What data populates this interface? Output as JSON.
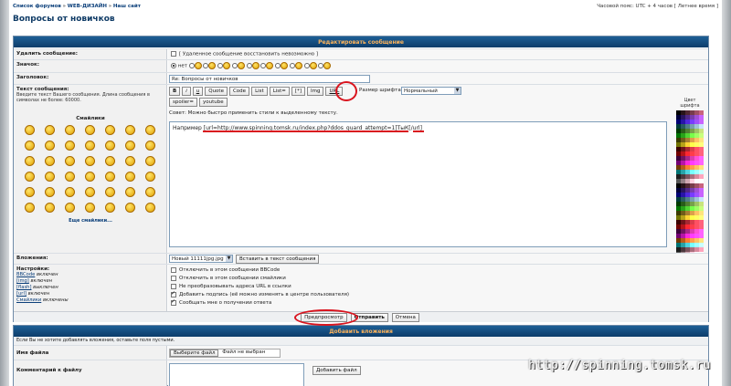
{
  "breadcrumbs": [
    "Список форумов",
    "WEB-ДИЗАЙН",
    "Наш сайт"
  ],
  "breadcrumb_sep": "»",
  "timezone": "Часовой пояс: UTC + 4 часов [ Летнее время ]",
  "page_title": "Вопросы от новичков",
  "edit_section_title": "Редактировать сообщение",
  "delete": {
    "label": "Удалить сообщение:",
    "text": "[ Удаленное сообщение восстановить невозможно ]"
  },
  "icon": {
    "label": "Значок:",
    "none_label": "нет"
  },
  "subject": {
    "label": "Заголовок:",
    "value": "Re: Вопросы от новичков"
  },
  "message": {
    "label": "Текст сообщения:",
    "hint": "Введите текст Вашего сообщения. Длина сообщения в символах не более: 60000.",
    "value": "Например [url=http://www.spinning.tomsk.ru/index.php?ddos_guard_attempt=1]ТыК[/url]"
  },
  "smilies": {
    "title": "Смайлики",
    "more": "Еще смайлики..."
  },
  "bbcode_buttons": [
    "B",
    "i",
    "u",
    "Quote",
    "Code",
    "List",
    "List=",
    "[*]",
    "Img",
    "URL",
    "spoiler=",
    "youtube"
  ],
  "font_size": {
    "label": "Размер шрифта:",
    "value": "Нормальный"
  },
  "tip": "Совет: Можно быстро применить стили к выделенному тексту.",
  "palette": {
    "caption": "Цвет шрифта"
  },
  "attachments": {
    "label": "Вложения:",
    "select_value": "Новый 11111jpg.jpg",
    "insert_button": "Вставить в текст сообщения"
  },
  "settings": {
    "label": "Настройки:",
    "items": [
      {
        "link": "BBCode",
        "state": "включен"
      },
      {
        "link": "[img]",
        "state": "включен"
      },
      {
        "link": "[flash]",
        "state": "выключен"
      },
      {
        "link": "[url]",
        "state": "включен"
      },
      {
        "link": "Смайлики",
        "state": "включены"
      }
    ]
  },
  "options": [
    {
      "text": "Отключить в этом сообщении BBCode",
      "checked": false
    },
    {
      "text": "Отключить в этом сообщении смайлики",
      "checked": false
    },
    {
      "text": "Не преобразовывать адреса URL в ссылки",
      "checked": false
    },
    {
      "text": "Добавить подпись (её можно изменять в центре пользователя)",
      "checked": true
    },
    {
      "text": "Сообщать мне о получении ответа",
      "checked": true
    }
  ],
  "buttons": {
    "preview": "Предпросмотр",
    "submit": "Отправить",
    "cancel": "Отмена"
  },
  "attach_section": {
    "title": "Добавить вложения",
    "note": "Если Вы не хотите добавлять вложения, оставьте поля пустыми.",
    "file_label": "Имя файла",
    "choose_button": "Выберите файл",
    "no_file": "Файл не выбран",
    "comment_label": "Комментарий к файлу",
    "add_button": "Добавить файл"
  },
  "watermark": "http://spinning.tomsk.ru",
  "colors": {
    "header": "#0c3c6a",
    "header_text": "#ffb45a",
    "annotation": "#d9141e",
    "title": "#0f3b66"
  }
}
